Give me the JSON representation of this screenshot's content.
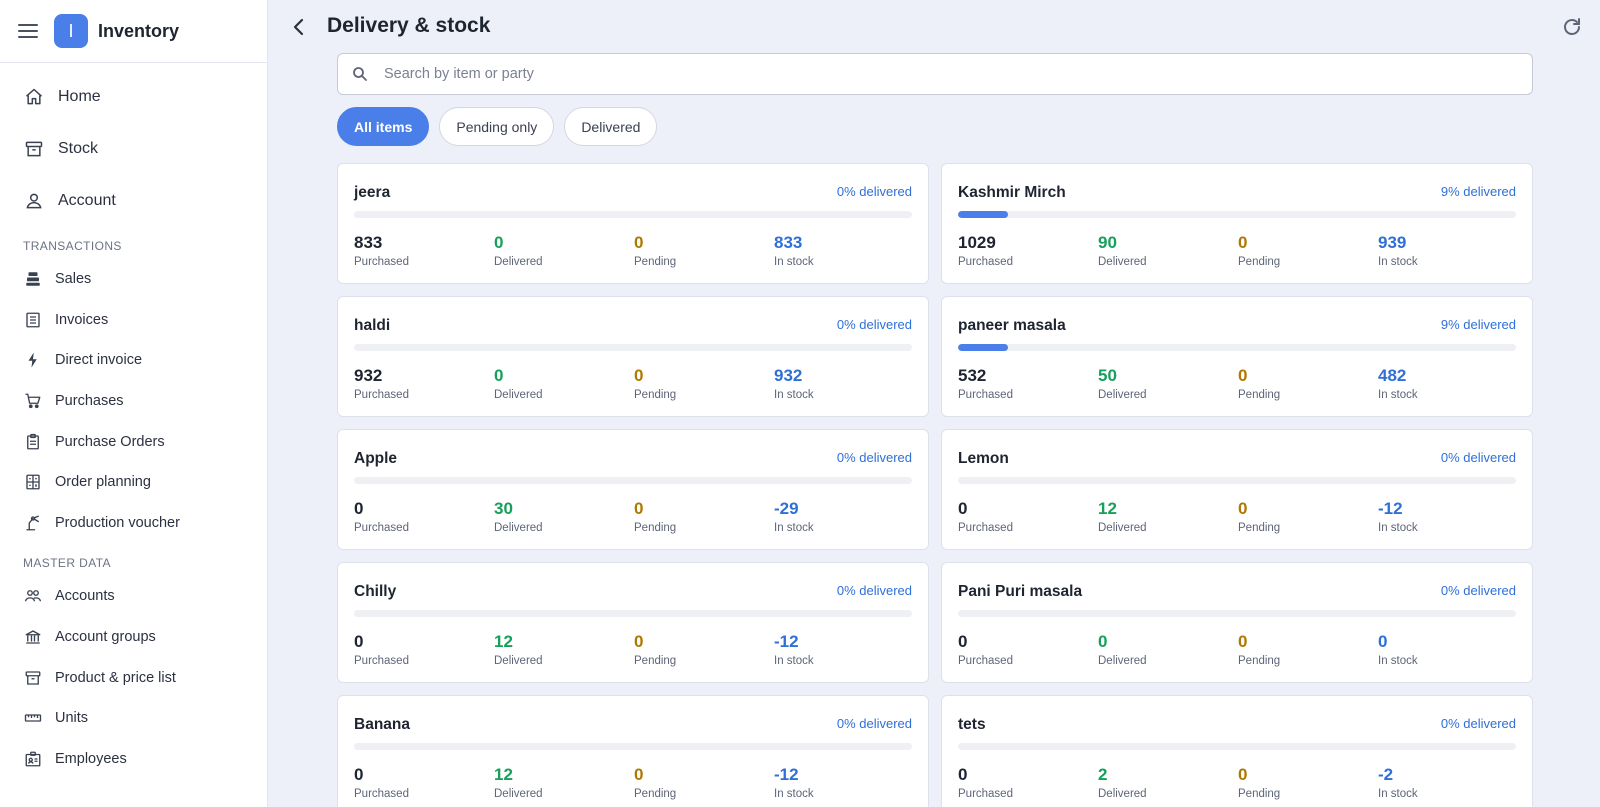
{
  "app": {
    "logo_letter": "I",
    "title": "Inventory"
  },
  "nav_main": [
    {
      "label": "Home",
      "icon": "home-icon"
    },
    {
      "label": "Stock",
      "icon": "archive-icon"
    },
    {
      "label": "Account",
      "icon": "user-icon"
    }
  ],
  "transactions": {
    "title": "TRANSACTIONS",
    "items": [
      {
        "label": "Sales",
        "icon": "cash-register-icon"
      },
      {
        "label": "Invoices",
        "icon": "list-icon"
      },
      {
        "label": "Direct invoice",
        "icon": "bolt-icon"
      },
      {
        "label": "Purchases",
        "icon": "cart-icon"
      },
      {
        "label": "Purchase Orders",
        "icon": "clipboard-icon"
      },
      {
        "label": "Order planning",
        "icon": "calculator-icon"
      },
      {
        "label": "Production voucher",
        "icon": "precision-tool-icon"
      }
    ]
  },
  "master_data": {
    "title": "MASTER DATA",
    "items": [
      {
        "label": "Accounts",
        "icon": "users-icon"
      },
      {
        "label": "Account groups",
        "icon": "bank-icon"
      },
      {
        "label": "Product & price list",
        "icon": "archive-icon"
      },
      {
        "label": "Units",
        "icon": "ruler-icon"
      },
      {
        "label": "Employees",
        "icon": "badge-icon"
      }
    ]
  },
  "header": {
    "title": "Delivery & stock"
  },
  "search": {
    "placeholder": "Search by item or party",
    "value": ""
  },
  "filters": [
    {
      "label": "All items",
      "active": true
    },
    {
      "label": "Pending only",
      "active": false
    },
    {
      "label": "Delivered",
      "active": false
    }
  ],
  "captions": {
    "purchased": "Purchased",
    "delivered": "Delivered",
    "pending": "Pending",
    "in_stock": "In stock"
  },
  "items": [
    {
      "name": "jeera",
      "pct_label": "0% delivered",
      "progress": 0,
      "purchased": "833",
      "delivered": "0",
      "pending": "0",
      "in_stock": "833"
    },
    {
      "name": "Kashmir Mirch",
      "pct_label": "9% delivered",
      "progress": 9,
      "purchased": "1029",
      "delivered": "90",
      "pending": "0",
      "in_stock": "939"
    },
    {
      "name": "haldi",
      "pct_label": "0% delivered",
      "progress": 0,
      "purchased": "932",
      "delivered": "0",
      "pending": "0",
      "in_stock": "932"
    },
    {
      "name": "paneer masala",
      "pct_label": "9% delivered",
      "progress": 9,
      "purchased": "532",
      "delivered": "50",
      "pending": "0",
      "in_stock": "482"
    },
    {
      "name": "Apple",
      "pct_label": "0% delivered",
      "progress": 0,
      "purchased": "0",
      "delivered": "30",
      "pending": "0",
      "in_stock": "-29"
    },
    {
      "name": "Lemon",
      "pct_label": "0% delivered",
      "progress": 0,
      "purchased": "0",
      "delivered": "12",
      "pending": "0",
      "in_stock": "-12"
    },
    {
      "name": "Chilly",
      "pct_label": "0% delivered",
      "progress": 0,
      "purchased": "0",
      "delivered": "12",
      "pending": "0",
      "in_stock": "-12"
    },
    {
      "name": "Pani Puri masala",
      "pct_label": "0% delivered",
      "progress": 0,
      "purchased": "0",
      "delivered": "0",
      "pending": "0",
      "in_stock": "0"
    },
    {
      "name": "Banana",
      "pct_label": "0% delivered",
      "progress": 0,
      "purchased": "0",
      "delivered": "12",
      "pending": "0",
      "in_stock": "-12"
    },
    {
      "name": "tets",
      "pct_label": "0% delivered",
      "progress": 0,
      "purchased": "0",
      "delivered": "2",
      "pending": "0",
      "in_stock": "-2"
    }
  ]
}
